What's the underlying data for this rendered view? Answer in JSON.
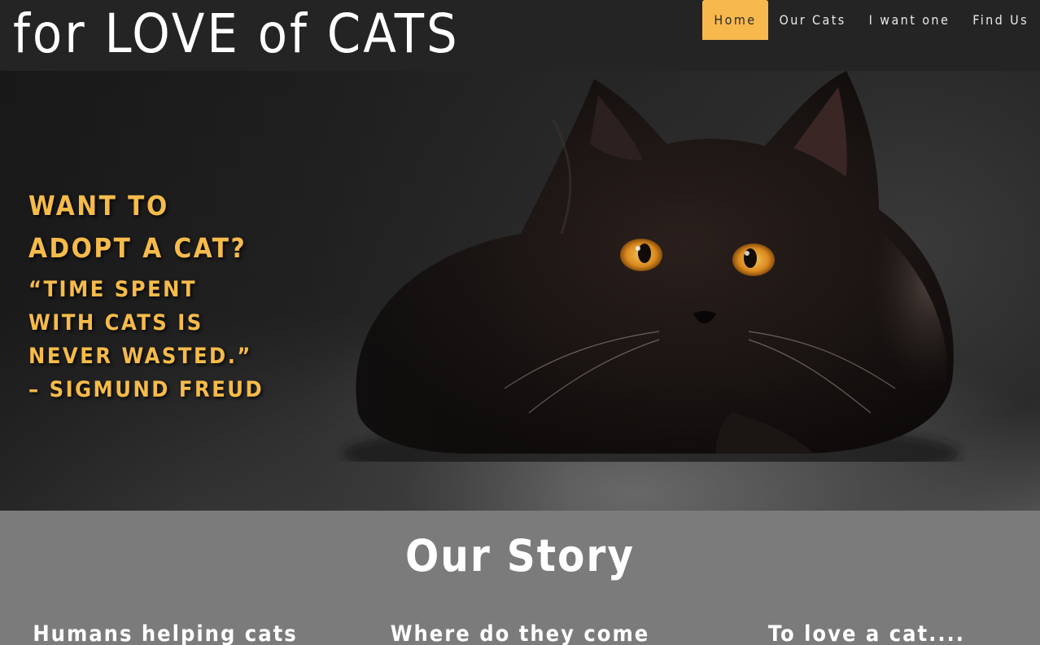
{
  "header": {
    "brand": "for LOVE of CATS",
    "nav": [
      {
        "label": "Home",
        "active": true
      },
      {
        "label": "Our Cats",
        "active": false
      },
      {
        "label": "I want one",
        "active": false
      },
      {
        "label": "Find Us",
        "active": false
      }
    ]
  },
  "hero": {
    "title": "Want to adopt a cat?",
    "quote": "“Time spent with cats is never wasted.” – Sigmund Freud"
  },
  "story": {
    "title": "Our Story",
    "columns": [
      {
        "heading": "Humans helping cats"
      },
      {
        "heading": "Where do they come"
      },
      {
        "heading": "To love a cat...."
      }
    ]
  },
  "colors": {
    "accent": "#f7b84e",
    "header_bg": "#242424",
    "story_bg": "#7b7b7b"
  }
}
